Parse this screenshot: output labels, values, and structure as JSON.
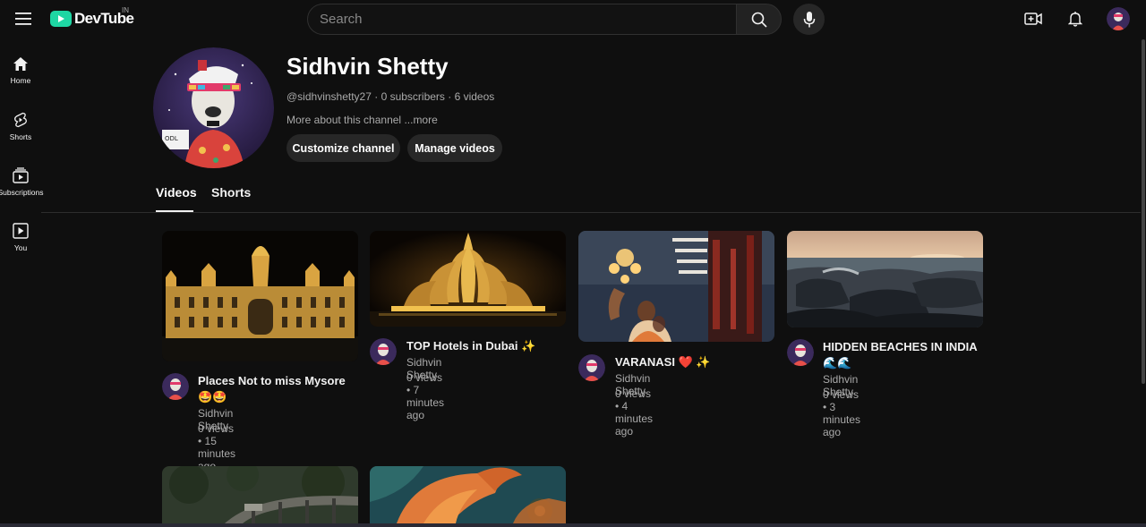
{
  "app": {
    "brand": "DevTube",
    "region": "IN",
    "colors": {
      "brand": "#1ed6a3",
      "background": "#0f0f0f",
      "surface": "#272727",
      "text_secondary": "#aaaaaa"
    }
  },
  "header": {
    "search_placeholder": "Search",
    "icons": [
      "menu-icon",
      "search-icon",
      "microphone-icon",
      "create-video-icon",
      "notifications-bell-icon",
      "account-avatar"
    ]
  },
  "sidebar": {
    "items": [
      {
        "label": "Home",
        "icon": "home-icon"
      },
      {
        "label": "Shorts",
        "icon": "shorts-icon"
      },
      {
        "label": "Subscriptions",
        "icon": "subscriptions-icon"
      },
      {
        "label": "You",
        "icon": "you-icon"
      }
    ]
  },
  "channel": {
    "name": "Sidhvin Shetty",
    "meta": "@sidhvinshetty27 · 0 subscribers · 6 videos",
    "about": "More about this channel",
    "more": "...more",
    "buttons": {
      "customize": "Customize channel",
      "manage": "Manage videos"
    }
  },
  "tabs": [
    {
      "label": "Videos",
      "selected": true
    },
    {
      "label": "Shorts",
      "selected": false
    }
  ],
  "videos": [
    {
      "title": "Places Not to miss Mysore 🤩🤩",
      "channel": "Sidhvin Shetty",
      "stats": "0 views • 15 minutes ago",
      "thumbnail": "illuminated-palace-at-night"
    },
    {
      "title": "TOP Hotels in Dubai ✨",
      "channel": "Sidhvin Shetty",
      "stats": "0 views • 7 minutes ago",
      "thumbnail": "golden-lotus-temple-at-night"
    },
    {
      "title": "VARANASI ❤️ ✨",
      "channel": "Sidhvin Shetty",
      "stats": "0 views • 4 minutes ago",
      "thumbnail": "evening-aarti-with-lamps"
    },
    {
      "title": "HIDDEN BEACHES IN INDIA 🌊🌊",
      "channel": "Sidhvin Shetty",
      "stats": "0 views • 3 minutes ago",
      "thumbnail": "rocky-beach-at-sunset"
    },
    {
      "thumbnail": "train-on-viaduct-in-forest"
    },
    {
      "thumbnail": "orange-koi-fish"
    }
  ]
}
